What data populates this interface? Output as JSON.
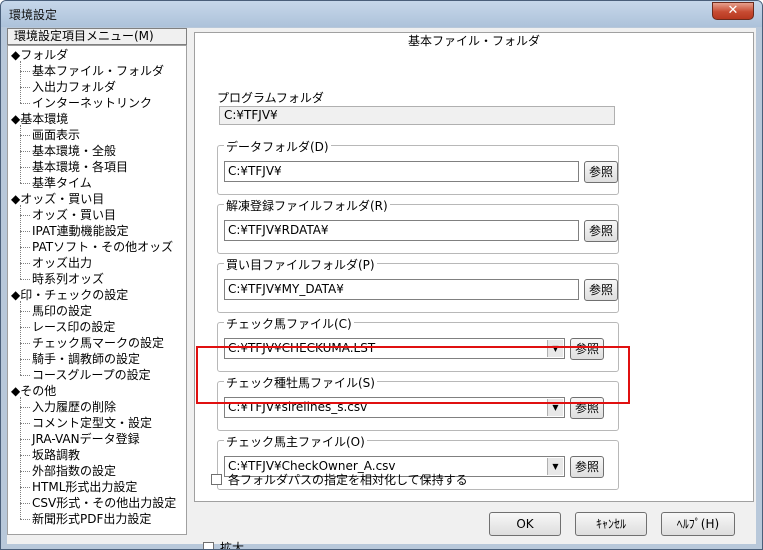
{
  "window": {
    "title": "環境設定",
    "close_glyph": "✕"
  },
  "menu": {
    "header": "環境設定項目メニュー(M)",
    "items": [
      {
        "label": "◆フォルダ",
        "level": 0
      },
      {
        "label": "基本ファイル・フォルダ",
        "level": 1
      },
      {
        "label": "入出力フォルダ",
        "level": 1
      },
      {
        "label": "インターネットリンク",
        "level": 1
      },
      {
        "label": "◆基本環境",
        "level": 0
      },
      {
        "label": "画面表示",
        "level": 1
      },
      {
        "label": "基本環境・全般",
        "level": 1
      },
      {
        "label": "基本環境・各項目",
        "level": 1
      },
      {
        "label": "基準タイム",
        "level": 1
      },
      {
        "label": "◆オッズ・買い目",
        "level": 0
      },
      {
        "label": "オッズ・買い目",
        "level": 1
      },
      {
        "label": "IPAT連動機能設定",
        "level": 1
      },
      {
        "label": "PATソフト・その他オッズ",
        "level": 1
      },
      {
        "label": "オッズ出力",
        "level": 1
      },
      {
        "label": "時系列オッズ",
        "level": 1
      },
      {
        "label": "◆印・チェックの設定",
        "level": 0
      },
      {
        "label": "馬印の設定",
        "level": 1
      },
      {
        "label": "レース印の設定",
        "level": 1
      },
      {
        "label": "チェック馬マークの設定",
        "level": 1
      },
      {
        "label": "騎手・調教師の設定",
        "level": 1
      },
      {
        "label": "コースグループの設定",
        "level": 1
      },
      {
        "label": "◆その他",
        "level": 0
      },
      {
        "label": "入力履歴の削除",
        "level": 1
      },
      {
        "label": "コメント定型文・設定",
        "level": 1
      },
      {
        "label": "JRA-VANデータ登録",
        "level": 1
      },
      {
        "label": "坂路調教",
        "level": 1
      },
      {
        "label": "外部指数の設定",
        "level": 1
      },
      {
        "label": "HTML形式出力設定",
        "level": 1
      },
      {
        "label": "CSV形式・その他出力設定",
        "level": 1
      },
      {
        "label": "新聞形式PDF出力設定",
        "level": 1
      }
    ]
  },
  "enlarge_label": "拡大",
  "panel": {
    "title": "基本ファイル・フォルダ",
    "program_folder": {
      "label": "プログラムフォルダ",
      "value": "C:¥TFJV¥"
    },
    "groups": [
      {
        "label": "データフォルダ(D)",
        "value": "C:¥TFJV¥",
        "type": "text"
      },
      {
        "label": "解凍登録ファイルフォルダ(R)",
        "value": "C:¥TFJV¥RDATA¥",
        "type": "text"
      },
      {
        "label": "買い目ファイルフォルダ(P)",
        "value": "C:¥TFJV¥MY_DATA¥",
        "type": "text"
      },
      {
        "label": "チェック馬ファイル(C)",
        "value": "C:¥TFJV¥CHECKUMA.LST",
        "type": "combo"
      },
      {
        "label": "チェック種牡馬ファイル(S)",
        "value": "C:¥TFJV¥sirelines_s.csv",
        "type": "combo"
      },
      {
        "label": "チェック馬主ファイル(O)",
        "value": "C:¥TFJV¥CheckOwner_A.csv",
        "type": "combo"
      }
    ],
    "browse_label": "参照",
    "relative_label": "各フォルダパスの指定を相対化して保持する"
  },
  "buttons": {
    "ok": "OK",
    "cancel": "ｷｬﾝｾﾙ",
    "help": "ﾍﾙﾌﾟ(H)"
  }
}
